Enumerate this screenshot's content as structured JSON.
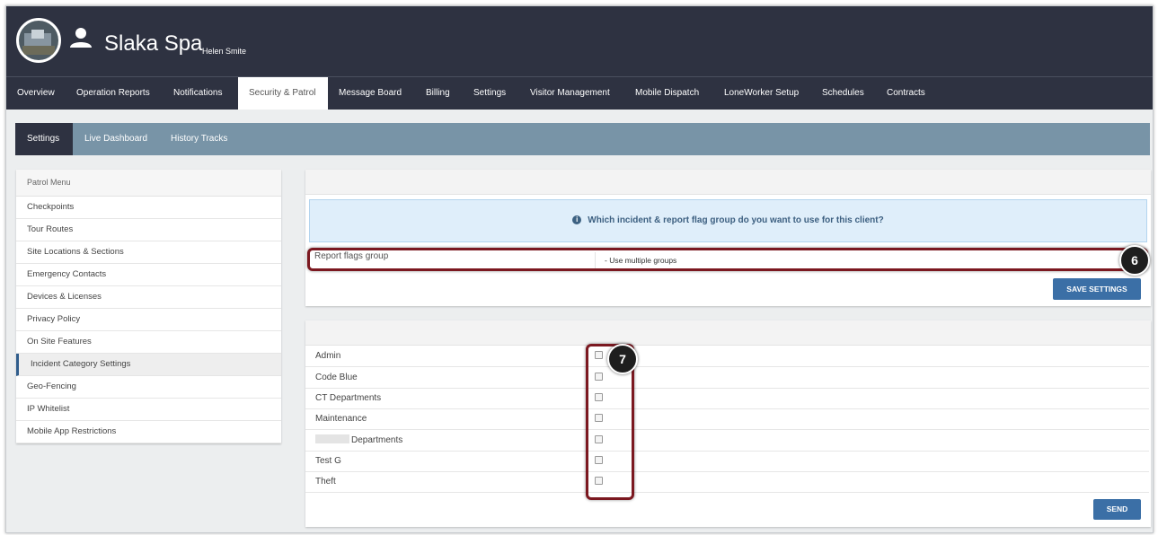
{
  "header": {
    "client_name": "Slaka Spa",
    "user_name": "Helen Smite"
  },
  "topnav": [
    {
      "label": "Overview"
    },
    {
      "label": "Operation Reports"
    },
    {
      "label": "Notifications"
    },
    {
      "label": "Security & Patrol",
      "active": true
    },
    {
      "label": "Message Board"
    },
    {
      "label": "Billing"
    },
    {
      "label": "Settings"
    },
    {
      "label": "Visitor Management"
    },
    {
      "label": "Mobile Dispatch"
    },
    {
      "label": "LoneWorker Setup"
    },
    {
      "label": "Schedules"
    },
    {
      "label": "Contracts"
    }
  ],
  "subnav": [
    {
      "label": "Settings",
      "active": true
    },
    {
      "label": "Live Dashboard"
    },
    {
      "label": "History Tracks"
    }
  ],
  "sidebar": {
    "title": "Patrol Menu",
    "items": [
      {
        "label": "Checkpoints"
      },
      {
        "label": "Tour Routes"
      },
      {
        "label": "Site Locations & Sections"
      },
      {
        "label": "Emergency Contacts"
      },
      {
        "label": "Devices & Licenses"
      },
      {
        "label": "Privacy Policy"
      },
      {
        "label": "On Site Features"
      },
      {
        "label": "Incident Category Settings",
        "active": true
      },
      {
        "label": "Geo-Fencing"
      },
      {
        "label": "IP Whitelist"
      },
      {
        "label": "Mobile App Restrictions"
      }
    ]
  },
  "flag_panel": {
    "alert_text": "Which incident & report flag group do you want to use for this client?",
    "field_label": "Report flags group",
    "field_value": "- Use multiple groups",
    "save_label": "SAVE SETTINGS",
    "step_badge": "6"
  },
  "categories_panel": {
    "items": [
      {
        "label": "Admin",
        "checked": false
      },
      {
        "label": "Code Blue",
        "checked": false
      },
      {
        "label": "CT Departments",
        "checked": false
      },
      {
        "label": "Maintenance",
        "checked": false
      },
      {
        "label": "Departments",
        "checked": false,
        "redacted_prefix": true
      },
      {
        "label": "Test G",
        "checked": false
      },
      {
        "label": "Theft",
        "checked": false
      }
    ],
    "send_label": "SEND",
    "step_badge": "7"
  },
  "colors": {
    "header_bg": "#2e3241",
    "subnav_bg": "#7894a7",
    "button_bg": "#3b6fa6",
    "highlight": "#7b1820",
    "alert_bg": "#dfeefa"
  }
}
